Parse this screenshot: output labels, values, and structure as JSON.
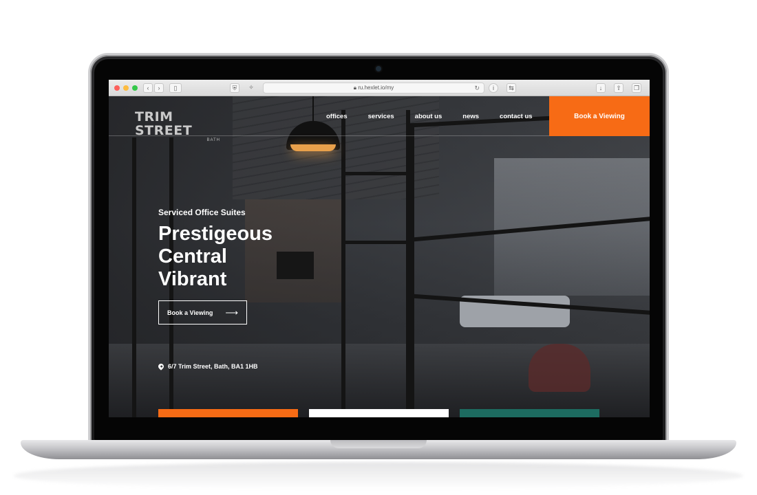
{
  "browser": {
    "url": "ru.hexlet.io/my",
    "icons": [
      "back-icon",
      "forward-icon",
      "sidebar-icon",
      "shield-icon",
      "extension-icon",
      "reload-icon",
      "info-icon",
      "translate-icon",
      "download-icon",
      "share-icon",
      "tabs-icon"
    ]
  },
  "header": {
    "logo_main": "TRIM STREET",
    "logo_sub": "BATH",
    "nav": [
      "offices",
      "services",
      "about us",
      "news",
      "contact us"
    ],
    "cta_label": "Book a Viewing"
  },
  "hero": {
    "eyebrow": "Serviced Office Suites",
    "headline": [
      "Prestigeous",
      "Central",
      "Vibrant"
    ],
    "button_label": "Book a Viewing",
    "button_arrow": "⟶",
    "address": "6/7 Trim Street, Bath, BA1 1HB"
  },
  "colors": {
    "accent": "#f76b15",
    "card_white": "#ffffff",
    "card_teal": "#1d6b60"
  }
}
